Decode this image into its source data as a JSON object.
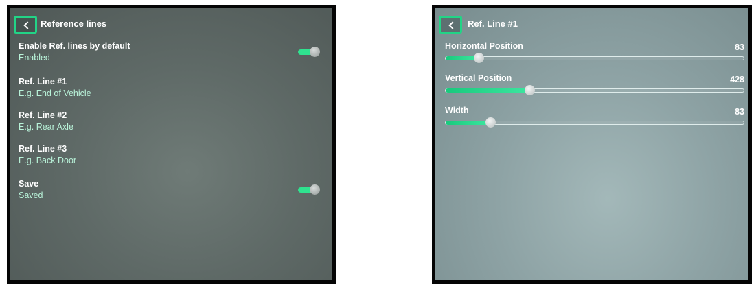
{
  "reference_lines_screen": {
    "title": "Reference lines",
    "items": [
      {
        "title": "Enable Ref. lines by default",
        "subtitle": "Enabled",
        "toggle_on": true
      },
      {
        "title": "Ref. Line #1",
        "subtitle": "E.g. End of Vehicle"
      },
      {
        "title": "Ref. Line #2",
        "subtitle": "E.g. Rear Axle"
      },
      {
        "title": "Ref. Line #3",
        "subtitle": "E.g. Back Door"
      },
      {
        "title": "Save",
        "subtitle": "Saved",
        "toggle_on": true
      }
    ]
  },
  "ref_line_1_screen": {
    "title": "Ref. Line #1",
    "sliders": [
      {
        "label": "Horizontal Position",
        "value": "83",
        "fill_fraction": 0.11
      },
      {
        "label": "Vertical Position",
        "value": "428",
        "fill_fraction": 0.28
      },
      {
        "label": "Width",
        "value": "83",
        "fill_fraction": 0.15
      }
    ]
  },
  "colors": {
    "accent": "#22d486",
    "subtitle": "#b9f3d9",
    "toggle_track": "#2fe38f"
  },
  "icons": {
    "back": "chevron-left-icon"
  }
}
